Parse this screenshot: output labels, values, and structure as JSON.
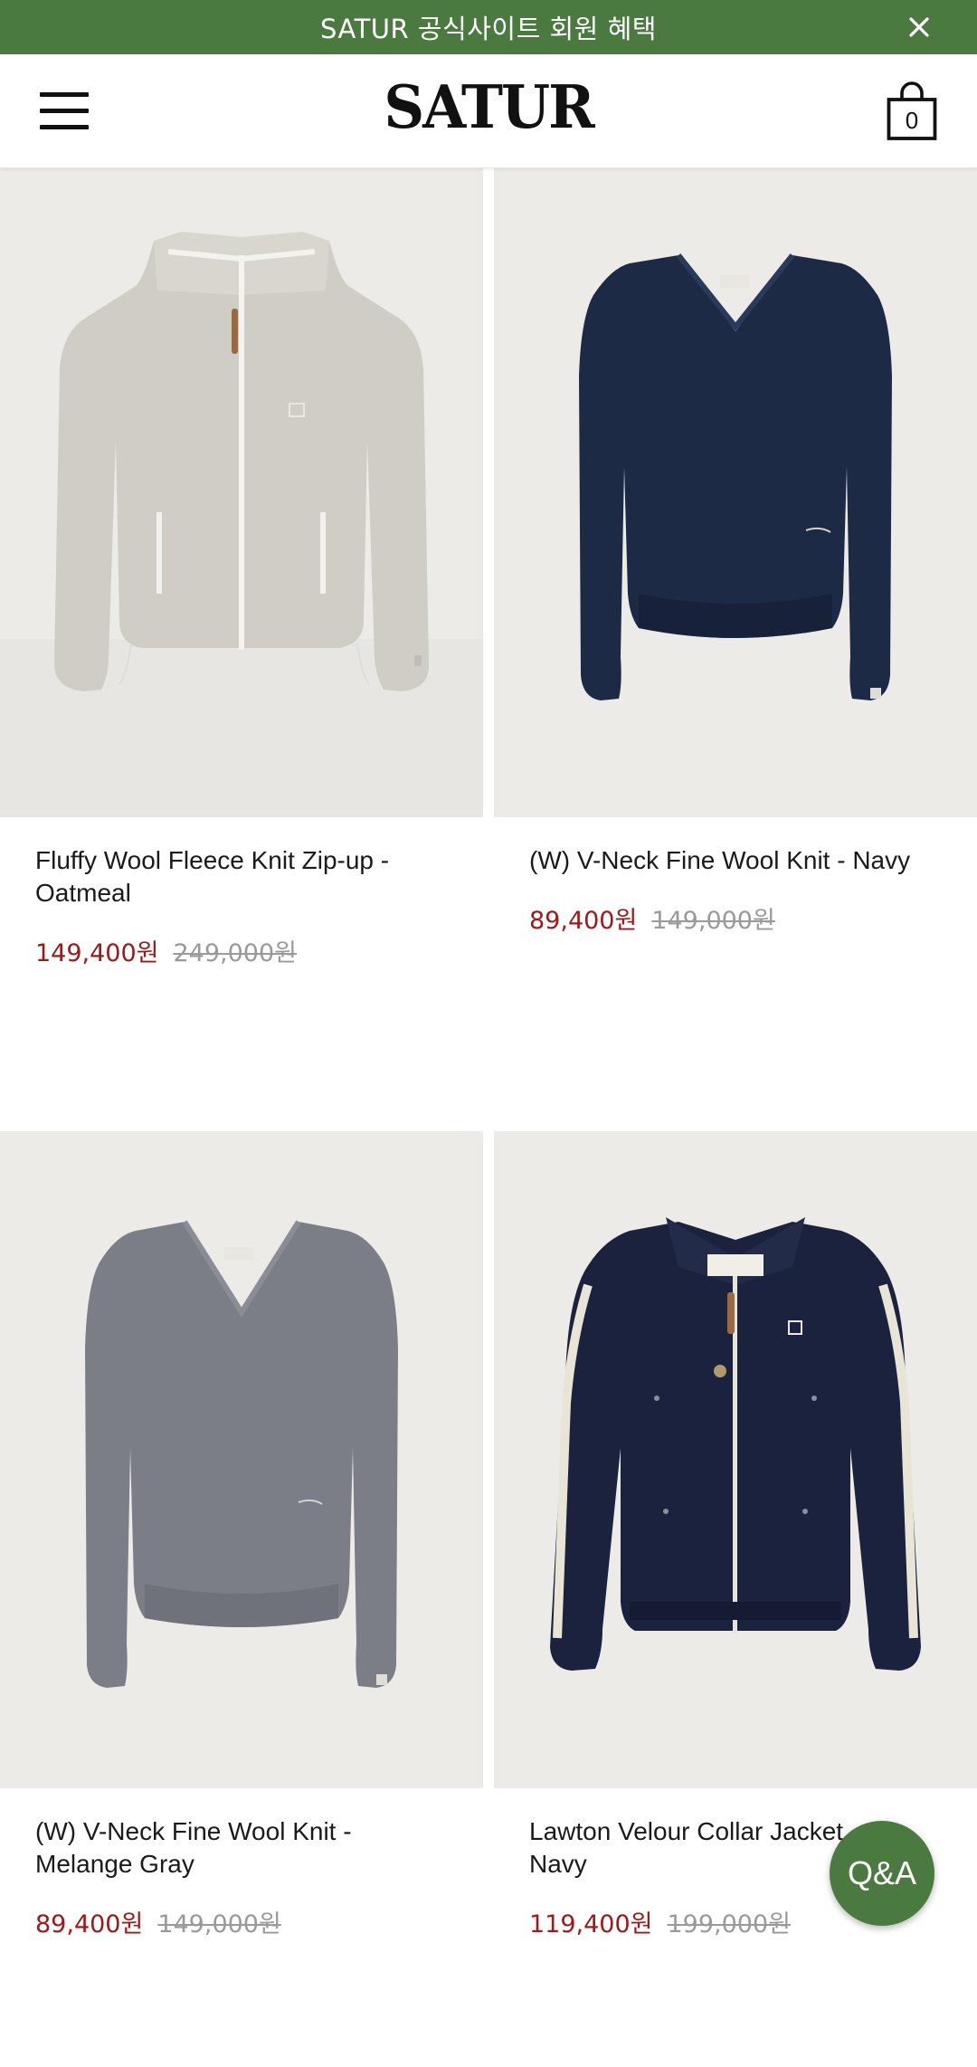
{
  "promo": {
    "text": "SATUR 공식사이트 회원 혜택",
    "close_icon": "close-icon"
  },
  "header": {
    "logo": "SATUR",
    "menu_icon": "hamburger-menu-icon",
    "cart_icon": "shopping-bag-icon",
    "cart_count": "0"
  },
  "products": [
    {
      "name": "Fluffy Wool Fleece Knit Zip-up - Oatmeal",
      "sale_price": "149,400원",
      "original_price": "249,000원"
    },
    {
      "name": "(W) V-Neck Fine Wool Knit - Navy",
      "sale_price": "89,400원",
      "original_price": "149,000원"
    },
    {
      "name": "(W) V-Neck Fine Wool Knit - Melange Gray",
      "sale_price": "89,400원",
      "original_price": "149,000원"
    },
    {
      "name": "Lawton Velour Collar Jacket - Navy",
      "sale_price": "119,400원",
      "original_price": "199,000원"
    }
  ],
  "qa_button": {
    "label": "Q&A"
  },
  "colors": {
    "brand_green": "#4a7a3f",
    "sale_red": "#a01818",
    "strike_gray": "#9a9a9a"
  }
}
